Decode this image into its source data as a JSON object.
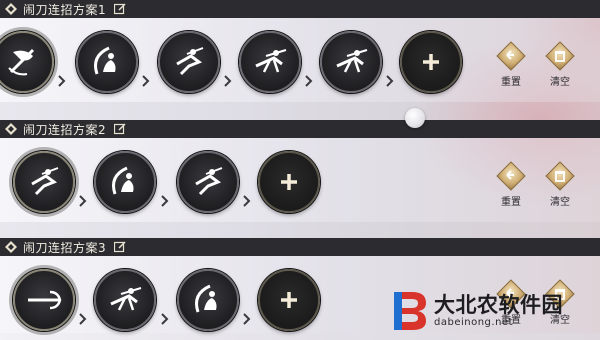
{
  "schemes": [
    {
      "title": "闹刀连招方案1",
      "slots": [
        "sword-spin-skill-icon",
        "crescent-slash-skill-icon",
        "leaping-strike-skill-icon",
        "dash-attack-skill-icon",
        "dash-attack-skill-icon",
        "add-slot-icon"
      ],
      "actions": {
        "reset_label": "重置",
        "clear_label": "清空"
      }
    },
    {
      "title": "闹刀连招方案2",
      "slots": [
        "leaping-strike-skill-icon",
        "crescent-slash-skill-icon",
        "leaping-strike-skill-icon",
        "add-slot-icon"
      ],
      "actions": {
        "reset_label": "重置",
        "clear_label": "清空"
      }
    },
    {
      "title": "闹刀连招方案3",
      "slots": [
        "trident-skill-icon",
        "dash-attack-skill-icon",
        "crescent-slash-skill-icon",
        "add-slot-icon"
      ],
      "actions": {
        "reset_label": "重置",
        "clear_label": "清空"
      }
    }
  ],
  "watermark": {
    "title": "大北农软件园",
    "subtitle": "dabeinong.net"
  },
  "colors": {
    "header_bg": "#2c2c30",
    "slot_bg": "#1e1e21",
    "gem_gold": "#c9a86a"
  }
}
